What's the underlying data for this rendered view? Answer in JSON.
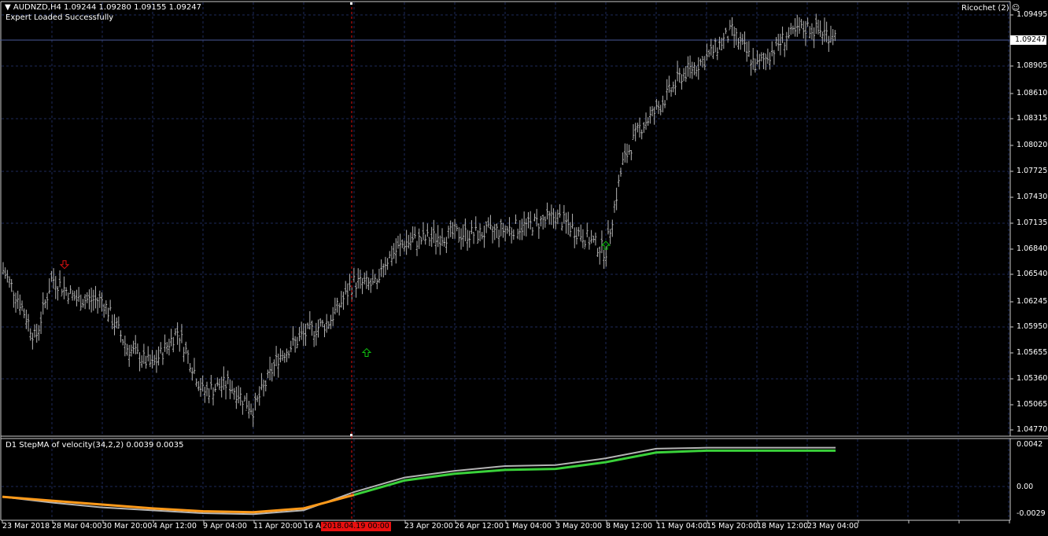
{
  "header": {
    "symbol_ohlc": "AUDNZD,H4  1.09244 1.09280 1.09155 1.09247",
    "status": "Expert Loaded Successfully",
    "ea_name": "Ricochet (2)",
    "ea_face": "☺"
  },
  "price_axis": [
    "1.09495",
    "1.09247",
    "1.08905",
    "1.08610",
    "1.08315",
    "1.08020",
    "1.07725",
    "1.07430",
    "1.07135",
    "1.06840",
    "1.06540",
    "1.06245",
    "1.05950",
    "1.05655",
    "1.05360",
    "1.05065",
    "1.04770"
  ],
  "current_price": "1.09247",
  "indicator": {
    "title": "D1 StepMA of velocity(34,2,2) 0.0039 0.0035",
    "axis": [
      "0.0042",
      "0.00",
      "-0.0029"
    ]
  },
  "time_axis": [
    "23 Mar 2018",
    "28 Mar 04:00",
    "30 Mar 20:00",
    "4 Apr 12:00",
    "9 Apr 04:00",
    "11 Apr 20:00",
    "16 A",
    "23 Apr 20:00",
    "26 Apr 12:00",
    "1 May 04:00",
    "3 May 20:00",
    "8 May 12:00",
    "11 May 04:00",
    "15 May 20:00",
    "18 May 12:00",
    "23 May 04:00"
  ],
  "cursor_time": "2018.04.19 00:00",
  "colors": {
    "background": "#000000",
    "grid": "#1e2a5a",
    "bars": "#b4b4b4",
    "sell_arrow": "#e01010",
    "buy_arrow": "#10c010",
    "indicator_orange": "#ff9a1a",
    "indicator_green": "#3ad13a",
    "indicator_gray": "#b4b4b4",
    "cursor_line": "#e01010"
  },
  "chart_data": {
    "type": "candlestick-ohlc",
    "symbol": "AUDNZD",
    "timeframe": "H4",
    "close_path": [
      [
        "23 Mar 2018",
        1.066
      ],
      [
        "25 Mar 2018",
        1.0625
      ],
      [
        "27 Mar 2018",
        1.058
      ],
      [
        "28 Mar 04:00",
        1.065
      ],
      [
        "29 Mar 2018",
        1.0625
      ],
      [
        "30 Mar 20:00",
        1.0625
      ],
      [
        "2 Apr 2018",
        1.057
      ],
      [
        "4 Apr 12:00",
        1.055
      ],
      [
        "6 Apr 2018",
        1.059
      ],
      [
        "9 Apr 04:00",
        1.052
      ],
      [
        "10 Apr 2018",
        1.053
      ],
      [
        "11 Apr 20:00",
        1.05
      ],
      [
        "13 Apr 2018",
        1.056
      ],
      [
        "16 Apr 2018",
        1.0585
      ],
      [
        "18 Apr 2018",
        1.06
      ],
      [
        "19 Apr 2018",
        1.0645
      ],
      [
        "20 Apr 2018",
        1.064
      ],
      [
        "23 Apr 20:00",
        1.0655
      ],
      [
        "24 Apr 2018",
        1.069
      ],
      [
        "26 Apr 12:00",
        1.07
      ],
      [
        "30 Apr 2018",
        1.07
      ],
      [
        "1 May 04:00",
        1.0705
      ],
      [
        "2 May 2018",
        1.071
      ],
      [
        "3 May 20:00",
        1.072
      ],
      [
        "7 May 2018",
        1.07
      ],
      [
        "8 May 12:00",
        1.068
      ],
      [
        "9 May 2018",
        1.078
      ],
      [
        "10 May 2018",
        1.082
      ],
      [
        "11 May 04:00",
        1.084
      ],
      [
        "14 May 2018",
        1.088
      ],
      [
        "15 May 20:00",
        1.09
      ],
      [
        "17 May 2018",
        1.093
      ],
      [
        "18 May 12:00",
        1.089
      ],
      [
        "21 May 2018",
        1.092
      ],
      [
        "23 May 04:00",
        1.0935
      ],
      [
        "24 May 2018",
        1.0925
      ]
    ],
    "signals": [
      {
        "type": "sell",
        "x": "28 Mar 04:00",
        "y": 1.0665
      },
      {
        "type": "buy",
        "x": "19 Apr 2018",
        "y": 1.0565
      },
      {
        "type": "buy",
        "x": "8 May 12:00",
        "y": 1.0687
      }
    ],
    "indicator_series": [
      {
        "values": [
          -0.0012,
          -0.0016,
          -0.002,
          -0.0024,
          -0.0027,
          -0.0028,
          -0.0024,
          -0.001,
          0.0005,
          0.0012,
          0.0016,
          0.0017,
          0.0024,
          0.0034,
          0.0036,
          0.0036
        ]
      },
      {
        "values": [
          -0.0012,
          -0.0018,
          -0.0023,
          -0.0026,
          -0.0029,
          -0.003,
          -0.0026,
          -0.0007,
          0.0008,
          0.0015,
          0.002,
          0.0021,
          0.0028,
          0.0038,
          0.0039,
          0.0039
        ]
      }
    ],
    "ylim": [
      1.0477,
      1.0949
    ],
    "indicator_ylim": [
      -0.0029,
      0.0042
    ]
  }
}
